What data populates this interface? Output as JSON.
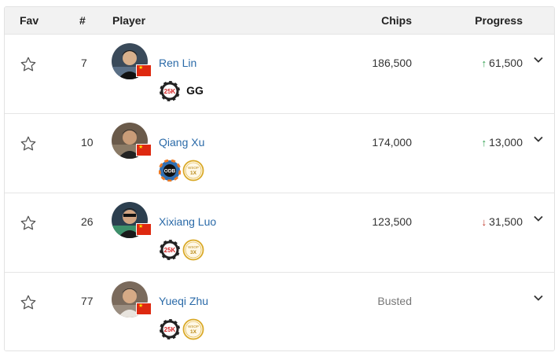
{
  "headers": {
    "fav": "Fav",
    "rank": "#",
    "player": "Player",
    "chips": "Chips",
    "progress": "Progress"
  },
  "colors": {
    "link": "#2a6aa8",
    "up": "#2a9d4a",
    "down": "#c0392b",
    "header_bg": "#f2f2f2",
    "flag": "#de2910"
  },
  "rows": [
    {
      "rank": "7",
      "name": "Ren Lin",
      "chips": "186,500",
      "direction": "up",
      "arrow": "↑",
      "progress": "61,500",
      "badges": [
        {
          "icon": "chip-25k-icon",
          "label": "25K"
        },
        {
          "icon": "gg-logo-icon",
          "label": "GG"
        }
      ]
    },
    {
      "rank": "10",
      "name": "Qiang Xu",
      "chips": "174,000",
      "direction": "up",
      "arrow": "↑",
      "progress": "13,000",
      "badges": [
        {
          "icon": "chip-odb-icon",
          "label": "ODB"
        },
        {
          "icon": "wsop-1x-icon",
          "label_top": "WSOP",
          "label": "1X"
        }
      ]
    },
    {
      "rank": "26",
      "name": "Xixiang Luo",
      "chips": "123,500",
      "direction": "down",
      "arrow": "↓",
      "progress": "31,500",
      "badges": [
        {
          "icon": "chip-25k-icon",
          "label": "25K"
        },
        {
          "icon": "wsop-3x-icon",
          "label_top": "WSOP",
          "label": "3X"
        }
      ]
    },
    {
      "rank": "77",
      "name": "Yueqi Zhu",
      "chips": "Busted",
      "direction": "none",
      "arrow": "",
      "progress": "",
      "badges": [
        {
          "icon": "chip-25k-icon",
          "label": "25K"
        },
        {
          "icon": "wsop-1x-icon",
          "label_top": "WSOP",
          "label": "1X"
        }
      ]
    }
  ]
}
